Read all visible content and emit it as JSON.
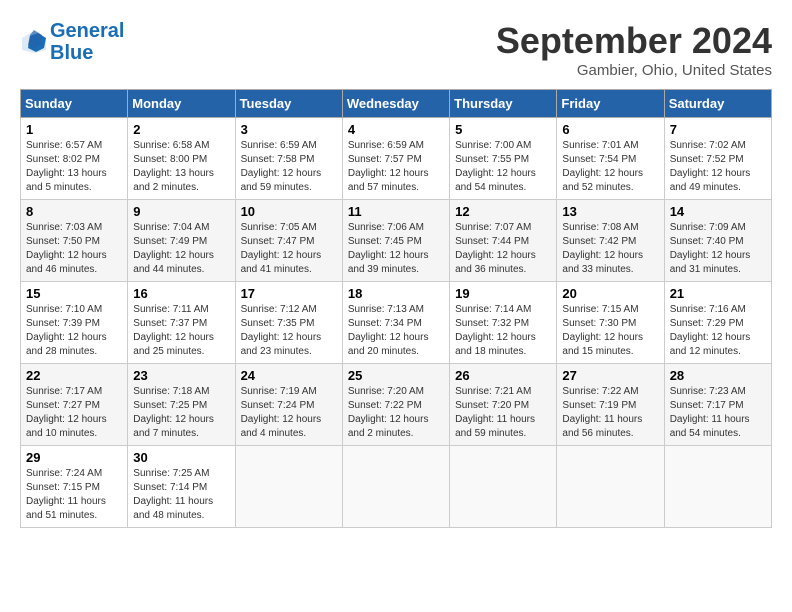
{
  "logo": {
    "line1": "General",
    "line2": "Blue"
  },
  "title": "September 2024",
  "subtitle": "Gambier, Ohio, United States",
  "headers": [
    "Sunday",
    "Monday",
    "Tuesday",
    "Wednesday",
    "Thursday",
    "Friday",
    "Saturday"
  ],
  "weeks": [
    [
      {
        "day": "1",
        "sunrise": "6:57 AM",
        "sunset": "8:02 PM",
        "daylight": "13 hours and 5 minutes."
      },
      {
        "day": "2",
        "sunrise": "6:58 AM",
        "sunset": "8:00 PM",
        "daylight": "13 hours and 2 minutes."
      },
      {
        "day": "3",
        "sunrise": "6:59 AM",
        "sunset": "7:58 PM",
        "daylight": "12 hours and 59 minutes."
      },
      {
        "day": "4",
        "sunrise": "6:59 AM",
        "sunset": "7:57 PM",
        "daylight": "12 hours and 57 minutes."
      },
      {
        "day": "5",
        "sunrise": "7:00 AM",
        "sunset": "7:55 PM",
        "daylight": "12 hours and 54 minutes."
      },
      {
        "day": "6",
        "sunrise": "7:01 AM",
        "sunset": "7:54 PM",
        "daylight": "12 hours and 52 minutes."
      },
      {
        "day": "7",
        "sunrise": "7:02 AM",
        "sunset": "7:52 PM",
        "daylight": "12 hours and 49 minutes."
      }
    ],
    [
      {
        "day": "8",
        "sunrise": "7:03 AM",
        "sunset": "7:50 PM",
        "daylight": "12 hours and 46 minutes."
      },
      {
        "day": "9",
        "sunrise": "7:04 AM",
        "sunset": "7:49 PM",
        "daylight": "12 hours and 44 minutes."
      },
      {
        "day": "10",
        "sunrise": "7:05 AM",
        "sunset": "7:47 PM",
        "daylight": "12 hours and 41 minutes."
      },
      {
        "day": "11",
        "sunrise": "7:06 AM",
        "sunset": "7:45 PM",
        "daylight": "12 hours and 39 minutes."
      },
      {
        "day": "12",
        "sunrise": "7:07 AM",
        "sunset": "7:44 PM",
        "daylight": "12 hours and 36 minutes."
      },
      {
        "day": "13",
        "sunrise": "7:08 AM",
        "sunset": "7:42 PM",
        "daylight": "12 hours and 33 minutes."
      },
      {
        "day": "14",
        "sunrise": "7:09 AM",
        "sunset": "7:40 PM",
        "daylight": "12 hours and 31 minutes."
      }
    ],
    [
      {
        "day": "15",
        "sunrise": "7:10 AM",
        "sunset": "7:39 PM",
        "daylight": "12 hours and 28 minutes."
      },
      {
        "day": "16",
        "sunrise": "7:11 AM",
        "sunset": "7:37 PM",
        "daylight": "12 hours and 25 minutes."
      },
      {
        "day": "17",
        "sunrise": "7:12 AM",
        "sunset": "7:35 PM",
        "daylight": "12 hours and 23 minutes."
      },
      {
        "day": "18",
        "sunrise": "7:13 AM",
        "sunset": "7:34 PM",
        "daylight": "12 hours and 20 minutes."
      },
      {
        "day": "19",
        "sunrise": "7:14 AM",
        "sunset": "7:32 PM",
        "daylight": "12 hours and 18 minutes."
      },
      {
        "day": "20",
        "sunrise": "7:15 AM",
        "sunset": "7:30 PM",
        "daylight": "12 hours and 15 minutes."
      },
      {
        "day": "21",
        "sunrise": "7:16 AM",
        "sunset": "7:29 PM",
        "daylight": "12 hours and 12 minutes."
      }
    ],
    [
      {
        "day": "22",
        "sunrise": "7:17 AM",
        "sunset": "7:27 PM",
        "daylight": "12 hours and 10 minutes."
      },
      {
        "day": "23",
        "sunrise": "7:18 AM",
        "sunset": "7:25 PM",
        "daylight": "12 hours and 7 minutes."
      },
      {
        "day": "24",
        "sunrise": "7:19 AM",
        "sunset": "7:24 PM",
        "daylight": "12 hours and 4 minutes."
      },
      {
        "day": "25",
        "sunrise": "7:20 AM",
        "sunset": "7:22 PM",
        "daylight": "12 hours and 2 minutes."
      },
      {
        "day": "26",
        "sunrise": "7:21 AM",
        "sunset": "7:20 PM",
        "daylight": "11 hours and 59 minutes."
      },
      {
        "day": "27",
        "sunrise": "7:22 AM",
        "sunset": "7:19 PM",
        "daylight": "11 hours and 56 minutes."
      },
      {
        "day": "28",
        "sunrise": "7:23 AM",
        "sunset": "7:17 PM",
        "daylight": "11 hours and 54 minutes."
      }
    ],
    [
      {
        "day": "29",
        "sunrise": "7:24 AM",
        "sunset": "7:15 PM",
        "daylight": "11 hours and 51 minutes."
      },
      {
        "day": "30",
        "sunrise": "7:25 AM",
        "sunset": "7:14 PM",
        "daylight": "11 hours and 48 minutes."
      },
      null,
      null,
      null,
      null,
      null
    ]
  ]
}
